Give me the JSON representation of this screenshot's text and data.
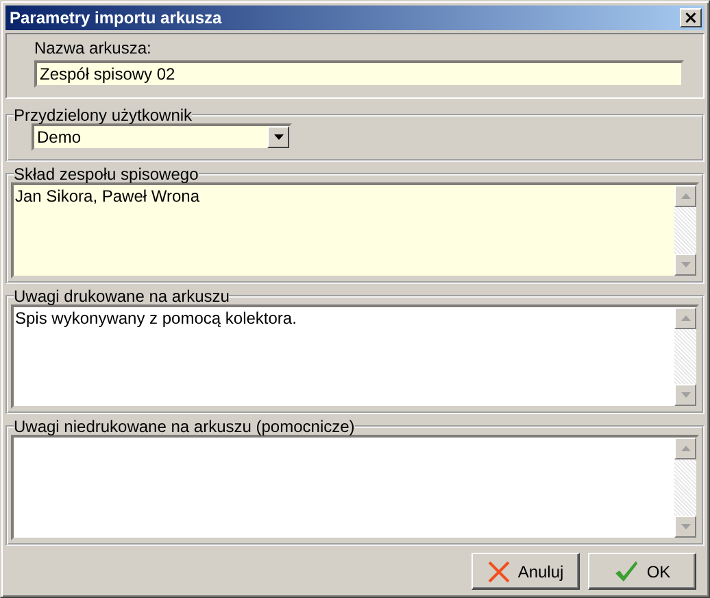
{
  "window": {
    "title": "Parametry importu arkusza",
    "close": "×"
  },
  "sheet_name": {
    "label": "Nazwa arkusza:",
    "value": "Zespół spisowy 02"
  },
  "assigned_user": {
    "legend": "Przydzielony użytkownik",
    "value": "Demo"
  },
  "text_areas": [
    {
      "legend": "Skład zespołu spisowego",
      "value": "Jan Sikora, Paweł Wrona",
      "highlighted": true
    },
    {
      "legend": "Uwagi drukowane na arkuszu",
      "value": "Spis wykonywany z pomocą kolektora.",
      "highlighted": false
    },
    {
      "legend": "Uwagi niedrukowane na arkuszu (pomocnicze)",
      "highlighted": false
    }
  ],
  "buttons": [
    {
      "label": "Anuluj",
      "kind": "cancel"
    },
    {
      "label": "OK",
      "kind": "ok"
    }
  ]
}
